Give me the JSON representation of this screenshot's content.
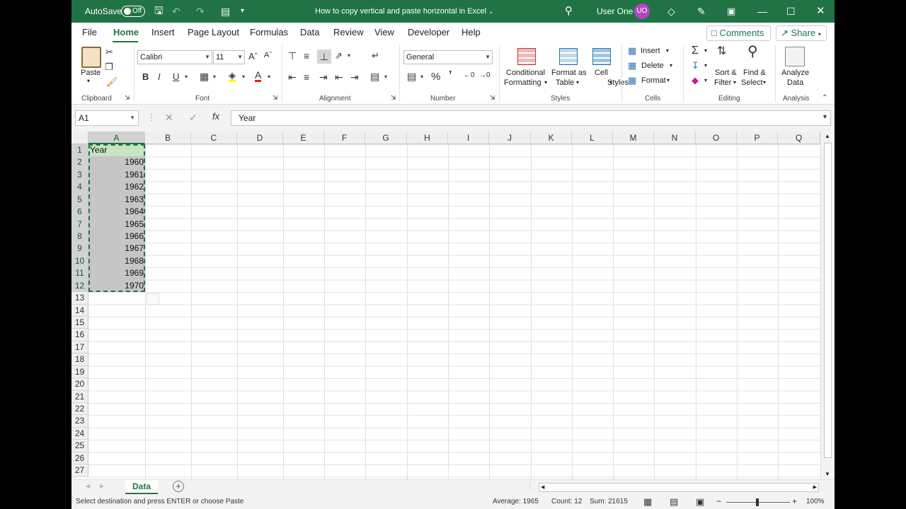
{
  "titlebar": {
    "autosave_label": "AutoSave",
    "autosave_state": "Off",
    "doc_title": "How to copy vertical and paste horizontal in Excel",
    "user_name": "User One",
    "user_initials": "UO"
  },
  "menu": {
    "items": [
      "File",
      "Home",
      "Insert",
      "Page Layout",
      "Formulas",
      "Data",
      "Review",
      "View",
      "Developer",
      "Help"
    ],
    "comments": "Comments",
    "share": "Share"
  },
  "ribbon": {
    "paste": "Paste",
    "clipboard": "Clipboard",
    "font_name": "Calibri",
    "font_size": "11",
    "font": "Font",
    "alignment": "Alignment",
    "number_format": "General",
    "number": "Number",
    "cond_fmt_1": "Conditional",
    "cond_fmt_2": "Formatting",
    "fmt_table_1": "Format as",
    "fmt_table_2": "Table",
    "cell_styles_1": "Cell",
    "cell_styles_2": "Styles",
    "styles": "Styles",
    "insert": "Insert",
    "delete": "Delete",
    "format": "Format",
    "cells": "Cells",
    "sort_1": "Sort &",
    "sort_2": "Filter",
    "find_1": "Find &",
    "find_2": "Select",
    "editing": "Editing",
    "analyze_1": "Analyze",
    "analyze_2": "Data",
    "analysis": "Analysis"
  },
  "formula": {
    "namebox": "A1",
    "content": "Year"
  },
  "grid": {
    "columns": [
      "A",
      "B",
      "C",
      "D",
      "E",
      "F",
      "G",
      "H",
      "I",
      "J",
      "K",
      "L",
      "M",
      "N",
      "O",
      "P",
      "Q"
    ],
    "rows": [
      "1",
      "2",
      "3",
      "4",
      "5",
      "6",
      "7",
      "8",
      "9",
      "10",
      "11",
      "12",
      "13",
      "14",
      "15",
      "16",
      "17",
      "18",
      "19",
      "20",
      "21",
      "22",
      "23",
      "24",
      "25",
      "26",
      "27"
    ],
    "A": [
      "Year",
      "1960",
      "1961",
      "1962",
      "1963",
      "1964",
      "1965",
      "1966",
      "1967",
      "1968",
      "1969",
      "1970"
    ]
  },
  "sheets": {
    "active": "Data"
  },
  "status": {
    "message": "Select destination and press ENTER or choose Paste",
    "average": "Average: 1965",
    "count": "Count: 12",
    "sum": "Sum: 21615",
    "zoom": "100%"
  }
}
